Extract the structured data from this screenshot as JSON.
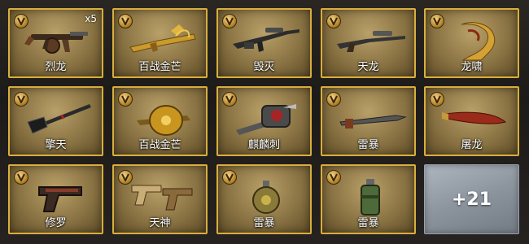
{
  "items": [
    {
      "name": "烈龙",
      "count": "x5",
      "icon": "tommy-gun-icon"
    },
    {
      "name": "百战金芒",
      "count": "",
      "icon": "golden-rifle-icon"
    },
    {
      "name": "毁灭",
      "count": "",
      "icon": "sniper-rifle-icon"
    },
    {
      "name": "天龙",
      "count": "",
      "icon": "scoped-rifle-icon"
    },
    {
      "name": "龙啸",
      "count": "",
      "icon": "dragon-ornament-icon"
    },
    {
      "name": "擎天",
      "count": "",
      "icon": "shovel-blade-icon"
    },
    {
      "name": "百战金芒",
      "count": "",
      "icon": "golden-shield-icon"
    },
    {
      "name": "麒麟刺",
      "count": "",
      "icon": "mech-gun-icon"
    },
    {
      "name": "雷暴",
      "count": "",
      "icon": "sword-icon"
    },
    {
      "name": "屠龙",
      "count": "",
      "icon": "red-knife-icon"
    },
    {
      "name": "修罗",
      "count": "",
      "icon": "pistol-icon"
    },
    {
      "name": "天神",
      "count": "",
      "icon": "dual-pistols-icon"
    },
    {
      "name": "雷暴",
      "count": "",
      "icon": "round-grenade-icon"
    },
    {
      "name": "雷暴",
      "count": "",
      "icon": "canister-grenade-icon"
    }
  ],
  "more": {
    "label": "+21"
  },
  "badge": {
    "letter_icon": "v-rank-badge-icon"
  },
  "colors": {
    "card_border": "#d9ae3c",
    "more_bg": "#8c949d"
  }
}
